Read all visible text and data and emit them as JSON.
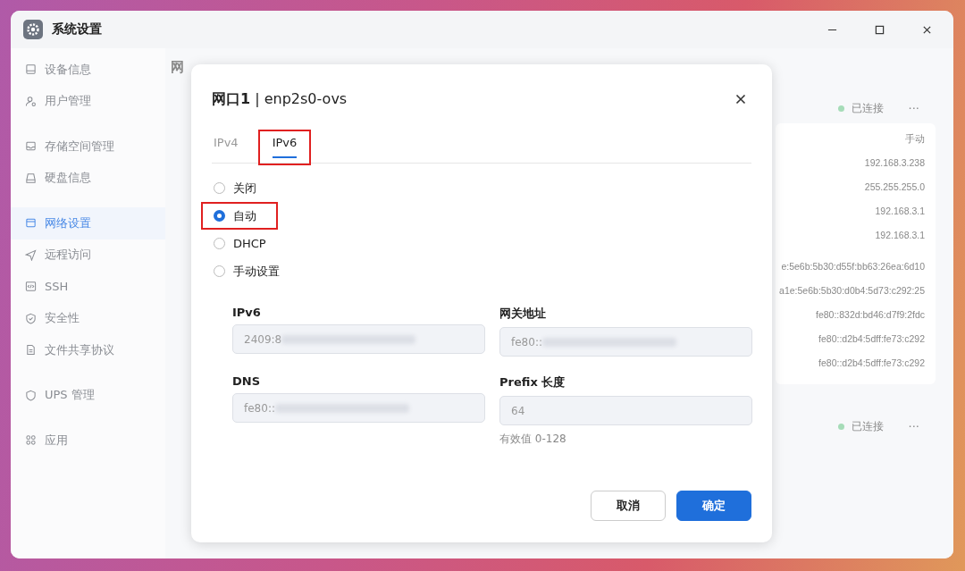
{
  "window": {
    "title": "系统设置"
  },
  "sidebar": {
    "groups": [
      {
        "items": [
          {
            "label": "设备信息",
            "kind": "device",
            "selected": false
          },
          {
            "label": "用户管理",
            "kind": "user",
            "selected": false
          }
        ]
      },
      {
        "items": [
          {
            "label": "存储空间管理",
            "kind": "storage",
            "selected": false
          },
          {
            "label": "硬盘信息",
            "kind": "disk",
            "selected": false
          }
        ]
      },
      {
        "items": [
          {
            "label": "网络设置",
            "kind": "network",
            "selected": true
          },
          {
            "label": "远程访问",
            "kind": "remote",
            "selected": false
          },
          {
            "label": "SSH",
            "kind": "ssh",
            "selected": false
          },
          {
            "label": "安全性",
            "kind": "security",
            "selected": false
          },
          {
            "label": "文件共享协议",
            "kind": "file",
            "selected": false
          }
        ]
      },
      {
        "items": [
          {
            "label": "UPS 管理",
            "kind": "ups",
            "selected": false
          }
        ]
      },
      {
        "items": [
          {
            "label": "应用",
            "kind": "apps",
            "selected": false
          }
        ]
      }
    ]
  },
  "main": {
    "heading": "网",
    "interfaces": [
      {
        "status": "已连接",
        "menu": "···",
        "values": [
          [
            "手动",
            "192.168.3.238",
            "255.255.255.0",
            "192.168.3.1",
            "192.168.3.1"
          ],
          [
            "e:5e6b:5b30:d55f:bb63:26ea:6d10",
            "a1e:5e6b:5b30:d0b4:5d73:c292:25",
            "fe80::832d:bd46:d7f9:2fdc",
            "fe80::d2b4:5dff:fe73:c292",
            "fe80::d2b4:5dff:fe73:c292"
          ]
        ]
      },
      {
        "status": "已连接",
        "menu": "···"
      }
    ]
  },
  "dialog": {
    "title_bold": "网口1",
    "title_rest": "| enp2s0-ovs",
    "tabs": [
      {
        "label": "IPv4",
        "selected": false,
        "highlighted": false
      },
      {
        "label": "IPv6",
        "selected": true,
        "highlighted": true
      }
    ],
    "options": [
      {
        "label": "关闭",
        "selected": false,
        "highlighted": false
      },
      {
        "label": "自动",
        "selected": true,
        "highlighted": true
      },
      {
        "label": "DHCP",
        "selected": false,
        "highlighted": false
      },
      {
        "label": "手动设置",
        "selected": false,
        "highlighted": false
      }
    ],
    "fields": [
      {
        "label": "IPv6",
        "value": "2409:8",
        "redacted": true
      },
      {
        "label": "网关地址",
        "value": "fe80::",
        "redacted": true
      },
      {
        "label": "DNS",
        "value": "fe80::",
        "redacted": true
      },
      {
        "label": "Prefix 长度",
        "value": "64",
        "redacted": false,
        "hint": "有效值 0-128"
      }
    ],
    "buttons": [
      {
        "label": "取消",
        "kind": "secondary"
      },
      {
        "label": "确定",
        "kind": "primary"
      }
    ]
  }
}
